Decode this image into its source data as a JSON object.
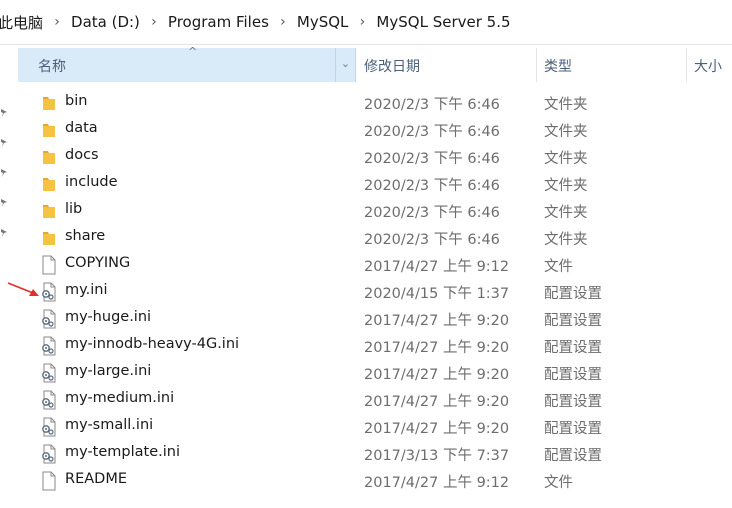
{
  "breadcrumb": [
    {
      "label": "此电脑"
    },
    {
      "label": "Data (D:)"
    },
    {
      "label": "Program Files"
    },
    {
      "label": "MySQL"
    },
    {
      "label": "MySQL Server 5.5"
    }
  ],
  "separator": "›",
  "columns": {
    "name": "名称",
    "date": "修改日期",
    "type": "类型",
    "size": "大小",
    "sort_indicator": "^",
    "dropdown": "⌄"
  },
  "files": [
    {
      "name": "bin",
      "date": "2020/2/3 下午 6:46",
      "type": "文件夹",
      "icon": "folder-icon"
    },
    {
      "name": "data",
      "date": "2020/2/3 下午 6:46",
      "type": "文件夹",
      "icon": "folder-icon"
    },
    {
      "name": "docs",
      "date": "2020/2/3 下午 6:46",
      "type": "文件夹",
      "icon": "folder-icon"
    },
    {
      "name": "include",
      "date": "2020/2/3 下午 6:46",
      "type": "文件夹",
      "icon": "folder-icon"
    },
    {
      "name": "lib",
      "date": "2020/2/3 下午 6:46",
      "type": "文件夹",
      "icon": "folder-icon"
    },
    {
      "name": "share",
      "date": "2020/2/3 下午 6:46",
      "type": "文件夹",
      "icon": "folder-icon"
    },
    {
      "name": "COPYING",
      "date": "2017/4/27 上午 9:12",
      "type": "文件",
      "icon": "file-icon"
    },
    {
      "name": "my.ini",
      "date": "2020/4/15 下午 1:37",
      "type": "配置设置",
      "icon": "settings-file-icon"
    },
    {
      "name": "my-huge.ini",
      "date": "2017/4/27 上午 9:20",
      "type": "配置设置",
      "icon": "settings-file-icon"
    },
    {
      "name": "my-innodb-heavy-4G.ini",
      "date": "2017/4/27 上午 9:20",
      "type": "配置设置",
      "icon": "settings-file-icon"
    },
    {
      "name": "my-large.ini",
      "date": "2017/4/27 上午 9:20",
      "type": "配置设置",
      "icon": "settings-file-icon"
    },
    {
      "name": "my-medium.ini",
      "date": "2017/4/27 上午 9:20",
      "type": "配置设置",
      "icon": "settings-file-icon"
    },
    {
      "name": "my-small.ini",
      "date": "2017/4/27 上午 9:20",
      "type": "配置设置",
      "icon": "settings-file-icon"
    },
    {
      "name": "my-template.ini",
      "date": "2017/3/13 下午 7:37",
      "type": "配置设置",
      "icon": "settings-file-icon"
    },
    {
      "name": "README",
      "date": "2017/4/27 上午 9:12",
      "type": "文件",
      "icon": "file-icon"
    }
  ],
  "colors": {
    "header_selected": "#d9ebf9",
    "folder": "#f5c342",
    "annotation_arrow": "#e0302a"
  }
}
